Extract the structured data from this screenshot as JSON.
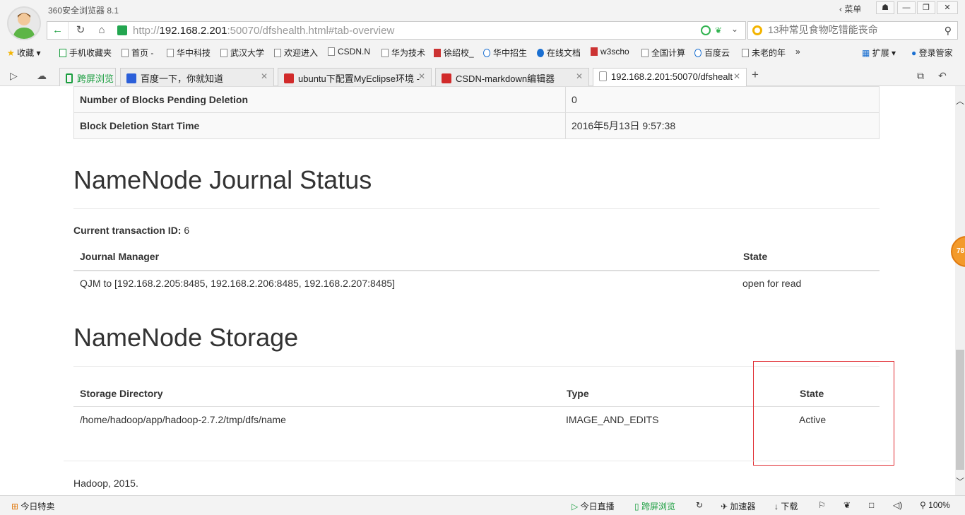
{
  "browser": {
    "app_title": "360安全浏览器 8.1",
    "menu_label": "菜单",
    "url_scheme": "http://",
    "url_host": "192.168.2.201",
    "url_rest": ":50070/dfshealth.html#tab-overview",
    "search_placeholder": "13种常见食物吃错能丧命",
    "bookmarks": {
      "favorites": "收藏",
      "mobile": "手机收藏夹",
      "home": "首页 -",
      "hust_tech": "华中科技",
      "whu": "武汉大学",
      "welcome": "欢迎进入",
      "csdn": "CSDN.N",
      "huawei": "华为技术",
      "xu": "徐绍校_",
      "hust_recruit": "华中招生",
      "online_docs": "在线文档",
      "w3school": "w3scho",
      "national": "全国计算",
      "baidu_cloud": "百度云",
      "old_year": "未老的年",
      "more": "»",
      "extensions": "扩展",
      "login": "登录管家"
    },
    "tabs": [
      {
        "label": "跨屏浏览"
      },
      {
        "label": "百度一下，你就知道"
      },
      {
        "label": "ubuntu下配置MyEclipse环境 -"
      },
      {
        "label": "CSDN-markdown编辑器"
      },
      {
        "label": "192.168.2.201:50070/dfshealt"
      }
    ],
    "new_tab": "+"
  },
  "page": {
    "top_table": [
      {
        "key": "Number of Blocks Pending Deletion",
        "value": "0"
      },
      {
        "key": "Block Deletion Start Time",
        "value": "2016年5月13日 9:57:38"
      }
    ],
    "journal": {
      "title": "NameNode Journal Status",
      "txn_label": "Current transaction ID:",
      "txn_value": "6",
      "headers": {
        "manager": "Journal Manager",
        "state": "State"
      },
      "rows": [
        {
          "manager": "QJM to [192.168.2.205:8485, 192.168.2.206:8485, 192.168.2.207:8485]",
          "state": "open for read"
        }
      ]
    },
    "storage": {
      "title": "NameNode Storage",
      "headers": {
        "dir": "Storage Directory",
        "type": "Type",
        "state": "State"
      },
      "rows": [
        {
          "dir": "/home/hadoop/app/hadoop-2.7.2/tmp/dfs/name",
          "type": "IMAGE_AND_EDITS",
          "state": "Active"
        }
      ]
    },
    "footer": "Hadoop, 2015.",
    "float_badge": "78"
  },
  "statusbar": {
    "today_deals": "今日特卖",
    "today_live": "今日直播",
    "cross_screen": "跨屏浏览",
    "accelerator": "加速器",
    "download": "下载",
    "zoom": "100%"
  },
  "colors": {
    "accent_green": "#1a9e3f",
    "highlight_red": "#e0282e"
  }
}
